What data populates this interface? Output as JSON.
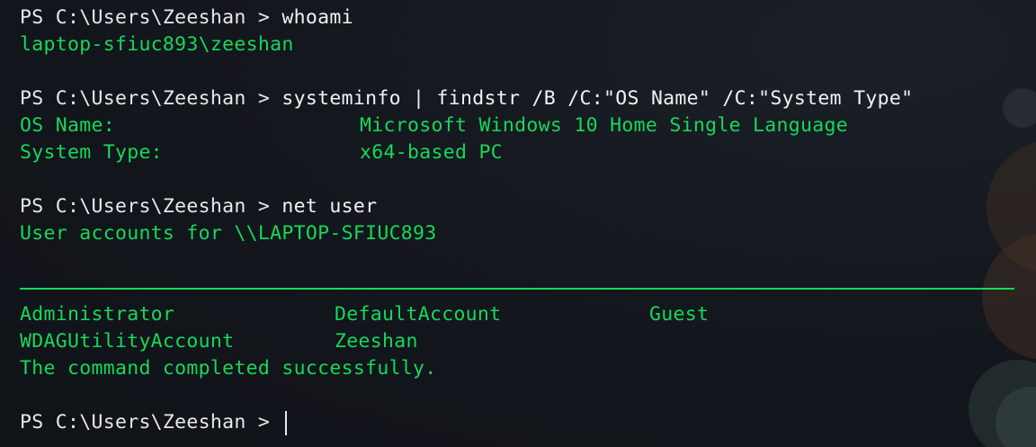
{
  "colors": {
    "background": "#12151b",
    "prompt_text": "#e8e8e8",
    "output_text": "#16d85a"
  },
  "prompt": "PS C:\\Users\\Zeeshan > ",
  "session": {
    "cmd1": "whoami",
    "out1": "laptop-sfiuc893\\zeeshan",
    "cmd2": "systeminfo | findstr /B /C:\"OS Name\" /C:\"System Type\"",
    "os_name_label": "OS Name:",
    "os_name_value": "Microsoft Windows 10 Home Single Language",
    "system_type_label": "System Type:",
    "system_type_value": "x64-based PC",
    "cmd3": "net user",
    "user_accounts_header": "User accounts for \\\\LAPTOP-SFIUC893",
    "accounts_row1": [
      "Administrator",
      "DefaultAccount",
      "Guest"
    ],
    "accounts_row2": [
      "WDAGUtilityAccount",
      "Zeeshan"
    ],
    "completion": "The command completed successfully."
  }
}
